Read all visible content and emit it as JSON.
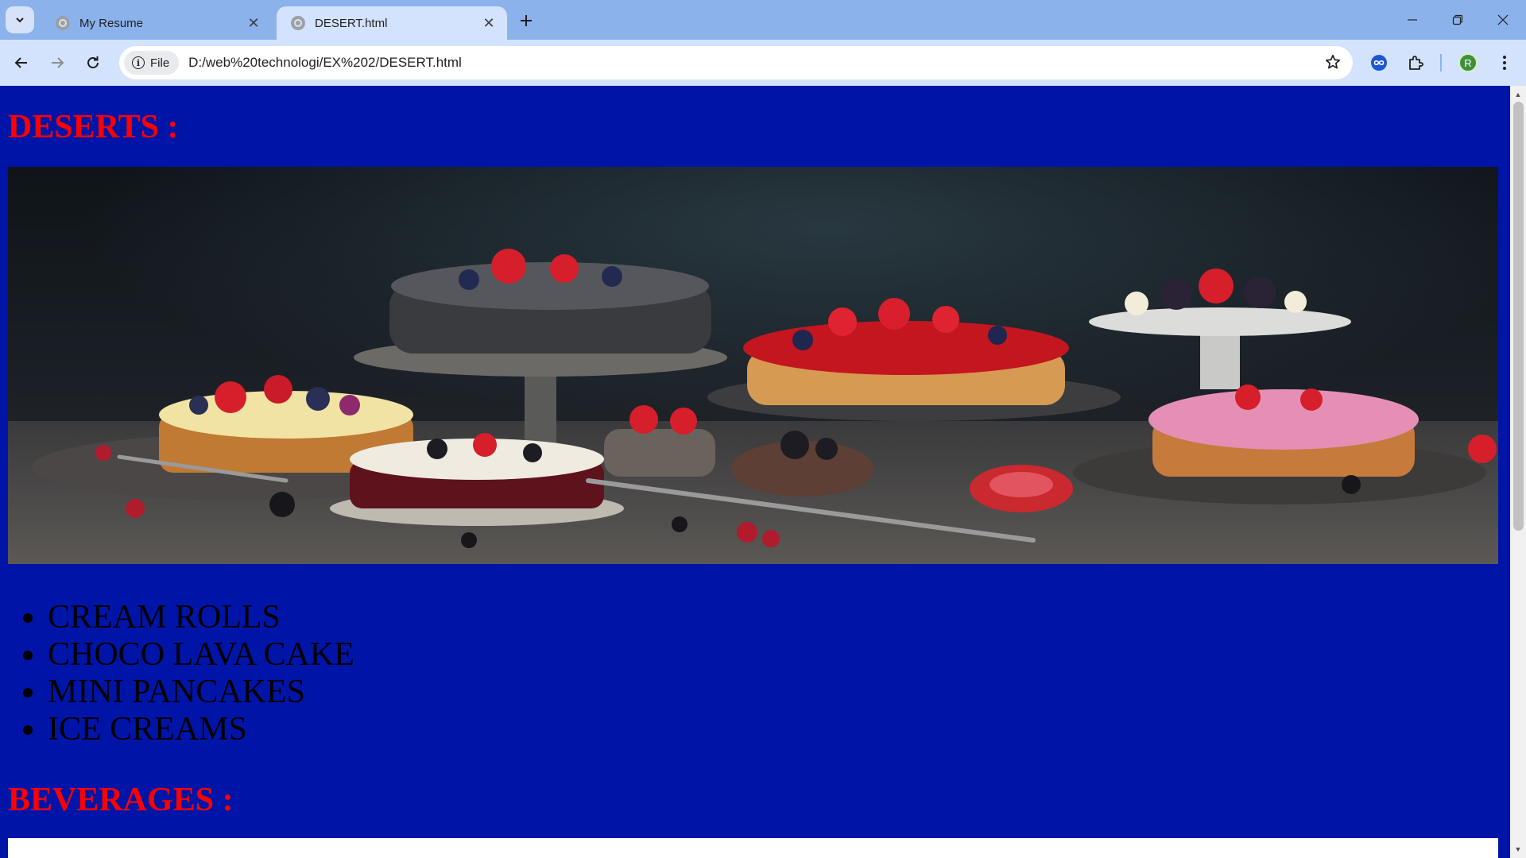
{
  "browser": {
    "tabs": [
      {
        "title": "My Resume",
        "active": false
      },
      {
        "title": "DESERT.html",
        "active": true
      }
    ],
    "site_chip_label": "File",
    "url": "D:/web%20technologi/EX%202/DESERT.html",
    "profile_initial": "R"
  },
  "page": {
    "heading_deserts": "DESERTS :",
    "hero_image_alt": "Assorted cakes and berry desserts on a dark table",
    "desserts": [
      "CREAM ROLLS",
      "CHOCO LAVA CAKE",
      "MINI PANCAKES",
      "ICE CREAMS"
    ],
    "heading_beverages": "BEVERAGES :"
  },
  "colors": {
    "page_background": "#0015a7",
    "heading_color": "#ff0000",
    "list_text_color": "#000000",
    "tabstrip": "#8cb2ec",
    "toolbar": "#d3e3fd"
  },
  "icons": {
    "tab_search": "chevron-down-icon",
    "tab_favicon": "globe-icon",
    "tab_close": "close-icon",
    "new_tab": "plus-icon",
    "minimize": "minimize-icon",
    "restore": "restore-icon",
    "window_close": "close-icon",
    "back": "back-arrow-icon",
    "forward": "forward-arrow-icon",
    "reload": "reload-icon",
    "site_info": "info-icon",
    "bookmark": "star-icon",
    "extension_infinity": "infinity-icon",
    "extensions": "puzzle-icon",
    "menu": "kebab-menu-icon"
  }
}
